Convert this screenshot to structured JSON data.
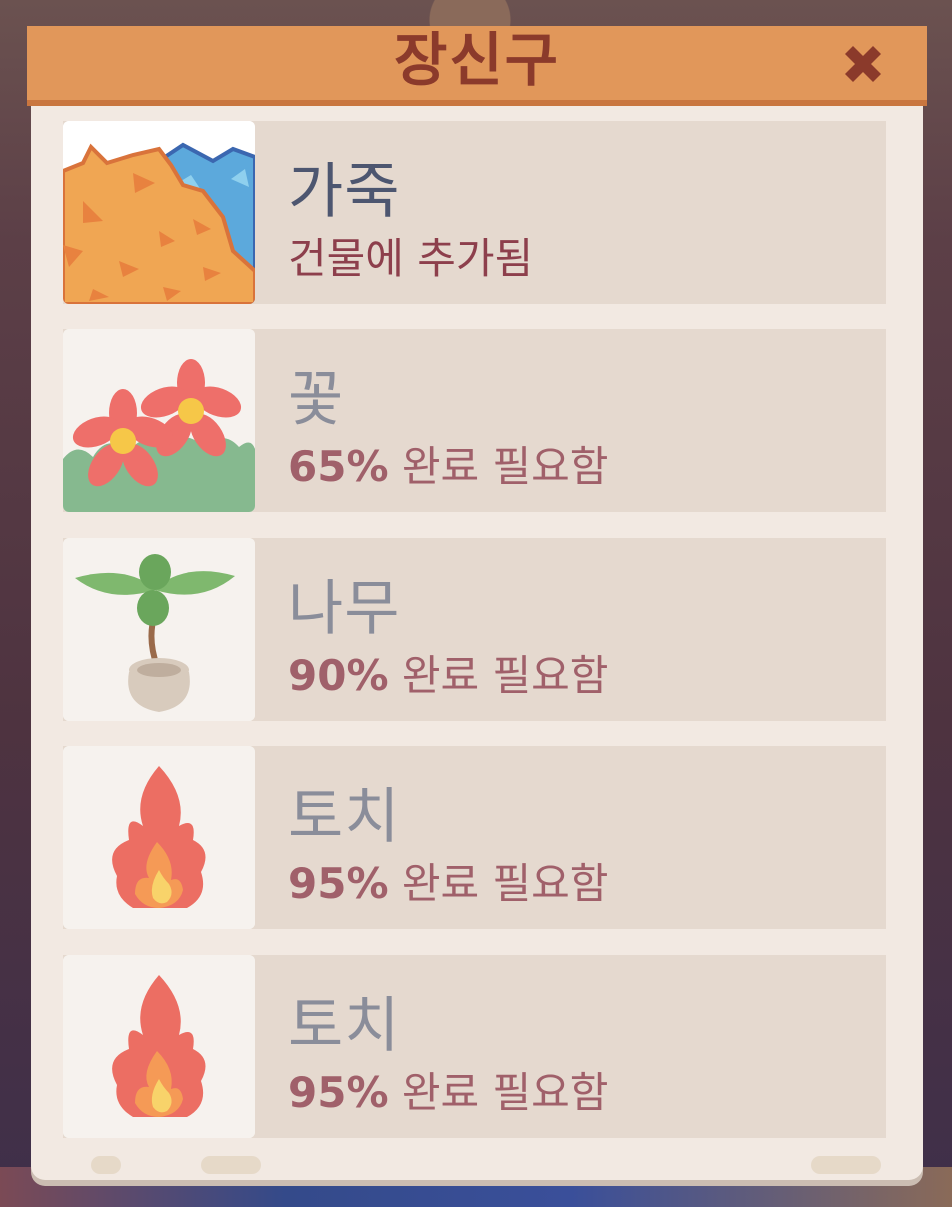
{
  "dialog": {
    "title": "장신구",
    "close_icon": "close-icon"
  },
  "colors": {
    "title_bar": "#e1975a",
    "title_text": "#8b3a2b",
    "panel": "#f2e9e2",
    "row": "#e5d9cf",
    "status_text": "#a0606a"
  },
  "items": [
    {
      "name": "가죽",
      "status_text": "건물에 추가됨",
      "percent": "",
      "suffix": "",
      "icon": "leather-icon",
      "unlocked": true
    },
    {
      "name": "꽃",
      "status_text": "",
      "percent": "65%",
      "suffix": " 완료 필요함",
      "icon": "flower-icon",
      "unlocked": false
    },
    {
      "name": "나무",
      "status_text": "",
      "percent": "90%",
      "suffix": " 완료 필요함",
      "icon": "potted-tree-icon",
      "unlocked": false
    },
    {
      "name": "토치",
      "status_text": "",
      "percent": "95%",
      "suffix": " 완료 필요함",
      "icon": "torch-fire-icon",
      "unlocked": false
    },
    {
      "name": "토치",
      "status_text": "",
      "percent": "95%",
      "suffix": " 완료 필요함",
      "icon": "torch-fire-icon",
      "unlocked": false
    }
  ]
}
